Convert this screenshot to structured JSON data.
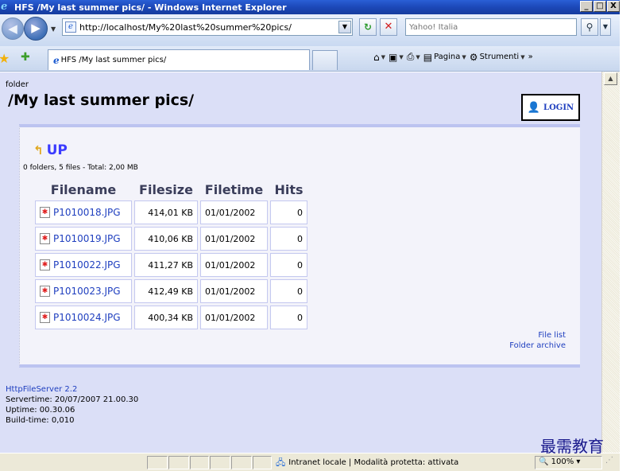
{
  "window": {
    "title": "HFS /My last summer pics/ - Windows Internet Explorer",
    "buttons": {
      "minimize": "_",
      "maximize": "□",
      "close": "X"
    }
  },
  "nav": {
    "address": "http://localhost/My%20last%20summer%20pics/",
    "search_placeholder": "Yahoo! Italia"
  },
  "tab": {
    "label": "HFS /My last summer pics/"
  },
  "commands": {
    "page_label": "Pagina",
    "tools_label": "Strumenti"
  },
  "page": {
    "folder_label": "folder",
    "folder_title": "/My last summer pics/",
    "login_label": "LOGIN",
    "up_label": "UP",
    "summary": "0 folders, 5 files - Total: 2,00 MB",
    "columns": [
      "Filename",
      "Filesize",
      "Filetime",
      "Hits"
    ],
    "files": [
      {
        "name": "P1010018.JPG",
        "size": "414,01 KB",
        "time": "01/01/2002",
        "hits": "0"
      },
      {
        "name": "P1010019.JPG",
        "size": "410,06 KB",
        "time": "01/01/2002",
        "hits": "0"
      },
      {
        "name": "P1010022.JPG",
        "size": "411,27 KB",
        "time": "01/01/2002",
        "hits": "0"
      },
      {
        "name": "P1010023.JPG",
        "size": "412,49 KB",
        "time": "01/01/2002",
        "hits": "0"
      },
      {
        "name": "P1010024.JPG",
        "size": "400,34 KB",
        "time": "01/01/2002",
        "hits": "0"
      }
    ],
    "links": {
      "file_list": "File list",
      "folder_archive": "Folder archive"
    },
    "footer": {
      "server": "HttpFileServer 2.2",
      "servertime": "Servertime: 20/07/2007 21.00.30",
      "uptime": "Uptime: 00.30.06",
      "buildtime": "Build-time: 0,010"
    }
  },
  "status": {
    "zone": "Intranet locale | Modalità protetta: attivata",
    "zoom": "100%"
  },
  "watermark": "最需教育"
}
